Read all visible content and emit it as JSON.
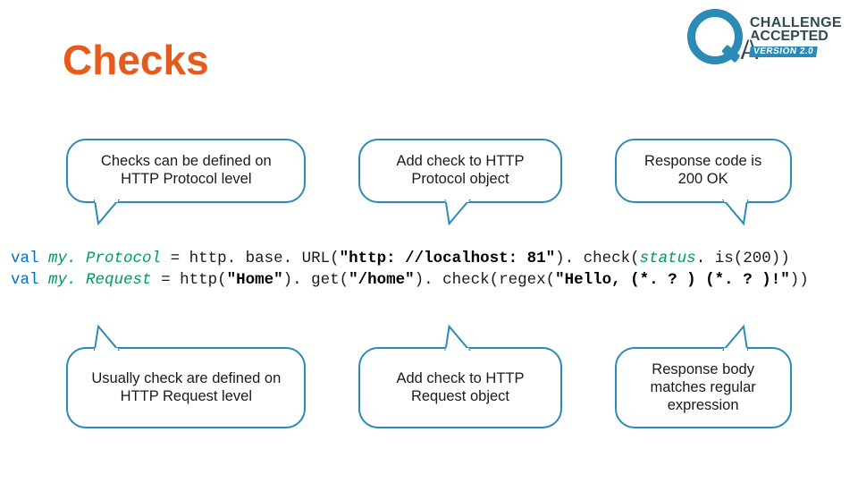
{
  "title": "Checks",
  "logo": {
    "line1": "CHALLENGE",
    "line2": "ACCEPTED",
    "version": "VERSION 2.0"
  },
  "bubbles_top": [
    "Checks can be defined on HTTP Protocol level",
    "Add check to HTTP Protocol object",
    "Response code is 200 OK"
  ],
  "bubbles_bottom": [
    "Usually check are defined on HTTP Request level",
    "Add check to HTTP Request object",
    "Response body matches regular expression"
  ],
  "code": {
    "kw": "val",
    "line1": {
      "var": "my. Protocol",
      "eq": " = http. base. URL(",
      "str1": "\"http: //localhost: 81\"",
      "mid": "). check(",
      "status_var": "status",
      "tail": ". is(200))"
    },
    "line2": {
      "var": "my. Request",
      "eq": " = http(",
      "str1": "\"Home\"",
      "mid1": "). get(",
      "str2": "\"/home\"",
      "mid2": "). check(regex(",
      "str3": "\"Hello, (*. ? ) (*. ? )!\"",
      "tail": "))"
    }
  }
}
